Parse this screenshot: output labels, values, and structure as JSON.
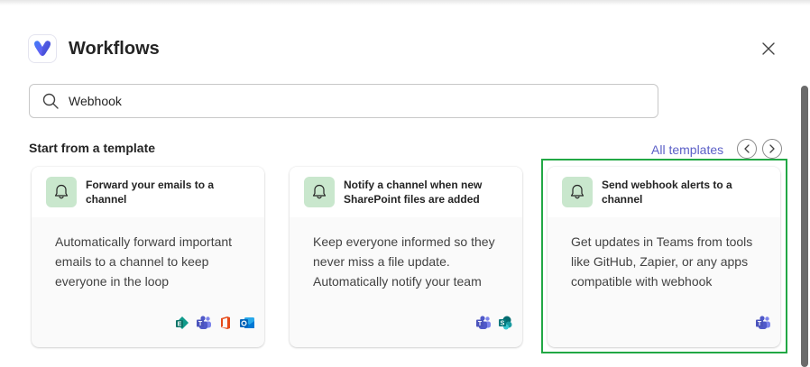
{
  "dialog": {
    "title": "Workflows",
    "close_icon": "close-icon"
  },
  "search": {
    "value": "Webhook",
    "placeholder": "Search"
  },
  "templates": {
    "section_title": "Start from a template",
    "all_templates_label": "All templates",
    "cards": [
      {
        "title": "Forward your emails to a channel",
        "description": "Automatically forward important emails to a channel to keep everyone in the loop",
        "apps": [
          "exchange-icon",
          "teams-icon",
          "office-icon",
          "outlook-icon"
        ]
      },
      {
        "title": "Notify a channel when new SharePoint files are added",
        "description": "Keep everyone informed so they never miss a file update. Automatically notify your team t...",
        "apps": [
          "teams-icon",
          "sharepoint-icon"
        ]
      },
      {
        "title": "Send webhook alerts to a channel",
        "description": "Get updates in Teams from tools like GitHub, Zapier, or any apps compatible with webhook",
        "apps": [
          "teams-icon"
        ]
      }
    ]
  },
  "colors": {
    "accent": "#5b5fc7",
    "bell_bg": "#c9e7cd",
    "highlight": "#22a845"
  }
}
